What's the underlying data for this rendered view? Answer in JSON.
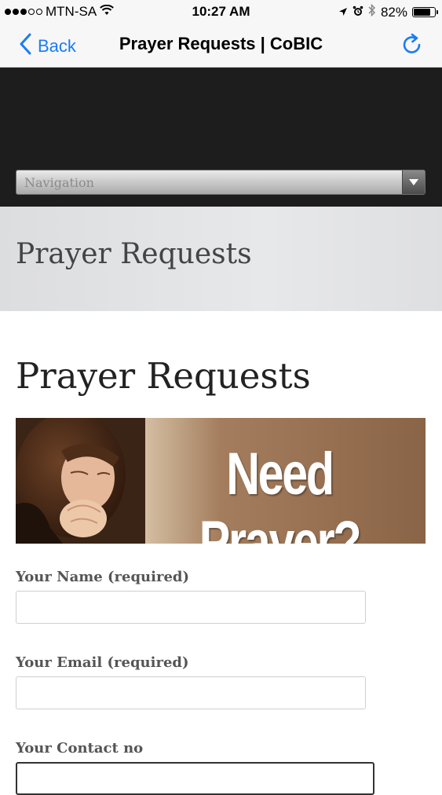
{
  "status_bar": {
    "carrier": "MTN-SA",
    "time": "10:27 AM",
    "battery": "82%",
    "battery_level": 0.82,
    "signal_bars_filled": 3,
    "signal_bars_total": 5,
    "icons": [
      "wifi-icon",
      "location-arrow-icon",
      "alarm-icon",
      "bluetooth-icon",
      "battery-icon"
    ]
  },
  "nav_bar": {
    "back_label": "Back",
    "title": "Prayer Requests | CoBIC",
    "accent_color": "#1a7cf5"
  },
  "site_nav": {
    "select_label": "Navigation"
  },
  "page_title_band": {
    "title": "Prayer Requests"
  },
  "main": {
    "heading": "Prayer Requests",
    "banner_text": "Need Prayer?"
  },
  "form": {
    "name_label": "Your Name (required)",
    "name_value": "",
    "email_label": "Your Email (required)",
    "email_value": "",
    "contact_label": "Your Contact no",
    "contact_value": ""
  }
}
